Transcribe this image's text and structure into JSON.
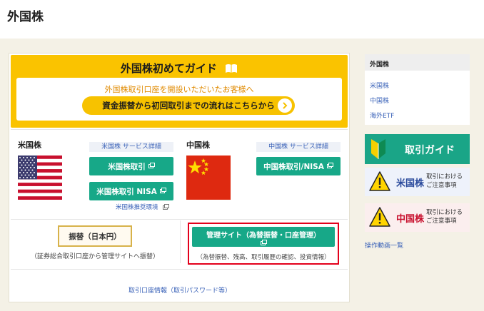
{
  "page": {
    "title": "外国株"
  },
  "banner": {
    "title": "外国株初めてガイド",
    "subtitle": "外国株取引口座を開設いただいたお客様へ",
    "flow_button": "資金振替から初回取引までの流れはこちらから"
  },
  "us": {
    "title": "米国株",
    "service_link": "米国株 サービス詳細",
    "trade_button": "米国株取引",
    "nisa_button": "米国株取引 NISA",
    "env_link": "米国株推奨環境"
  },
  "cn": {
    "title": "中国株",
    "service_link": "中国株 サービス詳細",
    "trade_button": "中国株取引/NISA"
  },
  "transfer": {
    "button": "振替（日本円）",
    "note": "（証券総合取引口座から管理サイトへ振替）"
  },
  "management": {
    "button": "管理サイト（為替振替・口座管理）",
    "note": "（為替振替、残高、取引履歴の確認、投資情報）"
  },
  "account_link": "取引口座情報（取引パスワード等）",
  "sidebar": {
    "heading": "外国株",
    "links": [
      "米国株",
      "中国株",
      "海外ETF"
    ],
    "guide_button": "取引ガイド",
    "us_notice": {
      "name": "米国株",
      "desc_line1": "取引における",
      "desc_line2": "ご注意事項"
    },
    "cn_notice": {
      "name": "中国株",
      "desc_line1": "取引における",
      "desc_line2": "ご注意事項"
    },
    "video_link": "操作動画一覧"
  },
  "colors": {
    "banner_yellow": "#fac300",
    "button_green": "#17a888",
    "highlight_red": "#e3001b",
    "link_blue": "#3a62b8",
    "background_beige": "#f4f1e6"
  }
}
